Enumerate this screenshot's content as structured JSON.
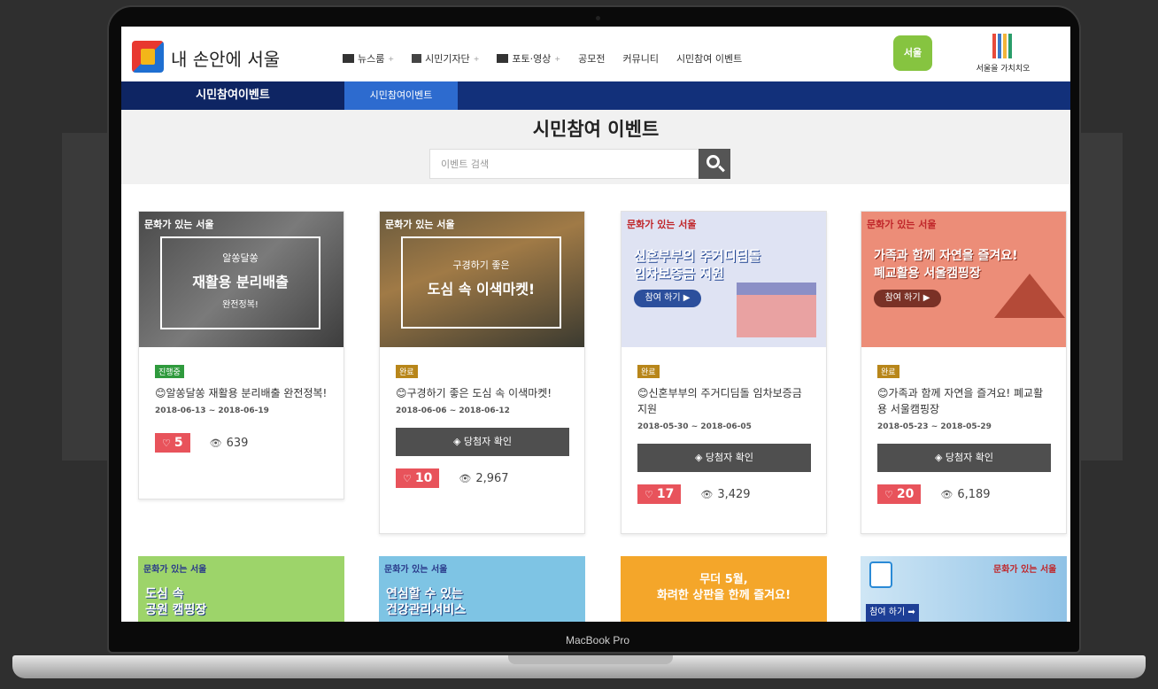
{
  "device": {
    "label": "MacBook Pro"
  },
  "header": {
    "logo_text": "내 손안에 서울",
    "nav": [
      {
        "label": "뉴스룸",
        "icon": "newspaper-icon",
        "caret": "+"
      },
      {
        "label": "시민기자단",
        "icon": "pen-icon",
        "caret": "+"
      },
      {
        "label": "포토·영상",
        "icon": "image-icon",
        "caret": "+"
      },
      {
        "label": "공모전"
      },
      {
        "label": "커뮤니티"
      },
      {
        "label": "시민참여 이벤트"
      }
    ],
    "badge_text": "서울",
    "value_logo_text": "서울을 가치치오"
  },
  "subnav": {
    "section_title": "시민참여이벤트",
    "active_tab": "시민참여이벤트"
  },
  "search": {
    "title": "시민참여 이벤트",
    "placeholder": "이벤트 검색"
  },
  "cards": [
    {
      "brand": "문화가 있는 서울",
      "image_lines": [
        "알쏭달쏭",
        "재활용 분리배출",
        "완전정복!"
      ],
      "status": "진행중",
      "title": "😊알쏭달쏭 재활용 분리배출 완전정복!",
      "dates": "2018-06-13 ~ 2018-06-19",
      "likes": "5",
      "views": "639"
    },
    {
      "brand": "문화가 있는 서울",
      "image_lines": [
        "구경하기 좋은",
        "도심 속 이색마켓!",
        ""
      ],
      "status": "완료",
      "title": "😊구경하기 좋은 도심 속 이색마켓!",
      "dates": "2018-06-06 ~ 2018-06-12",
      "winner_label": "당첨자 확인",
      "likes": "10",
      "views": "2,967"
    },
    {
      "brand": "문화가 있는 서울",
      "image_lines": [
        "신혼부부의 주거디딤돌",
        "임차보증금 지원"
      ],
      "image_button": "참여 하기 ▶",
      "status": "완료",
      "title": "😊신혼부부의 주거디딤돌 임차보증금 지원",
      "dates": "2018-05-30 ~ 2018-06-05",
      "winner_label": "당첨자 확인",
      "likes": "17",
      "views": "3,429"
    },
    {
      "brand": "문화가 있는 서울",
      "image_lines": [
        "가족과 함께 자연을 즐겨요!",
        "폐교활용 서울캠핑장"
      ],
      "image_button": "참여 하기 ▶",
      "status": "완료",
      "title": "😊가족과 함께 자연을 즐겨요! 폐교활용 서울캠핑장",
      "dates": "2018-05-23 ~ 2018-05-29",
      "winner_label": "당첨자 확인",
      "likes": "20",
      "views": "6,189"
    }
  ],
  "bottom_cards": [
    {
      "brand": "문화가 있는 서울",
      "text": [
        "도심 속",
        "공원 캠핑장"
      ]
    },
    {
      "brand": "문화가 있는 서울",
      "text": [
        "연심할 수 있는",
        "건강관리서비스"
      ]
    },
    {
      "text": [
        "무더 5월,",
        "화려한 상판을 한께 즐겨요!"
      ]
    },
    {
      "brand": "문화가 있는 서울",
      "button": "참여 하기 ➡"
    }
  ],
  "colors": {
    "subnav_dark": "#0e2563",
    "subnav_blue": "#12307a",
    "tab_active": "#2d6bcf",
    "like_red": "#e8535b",
    "status_green": "#2f9a3d",
    "status_gold": "#b8861a"
  }
}
